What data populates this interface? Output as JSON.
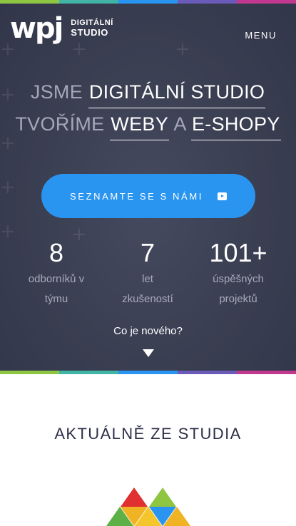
{
  "brand": {
    "logo_mark": "wpj",
    "logo_line1": "DIGITÁLNÍ",
    "logo_line2": "STUDIO"
  },
  "nav": {
    "menu_label": "MENU"
  },
  "hero": {
    "line1_prefix": "JSME",
    "line1_highlight": "DIGITÁLNÍ STUDIO",
    "line2_prefix": "TVOŘÍME",
    "line2_highlight1": "WEBY",
    "line2_connector": "A",
    "line2_highlight2": "E-SHOPY",
    "cta_label": "SEZNAMTE SE S NÁMI",
    "cta_icon": "play-icon"
  },
  "stats": [
    {
      "number": "8",
      "label_line1": "odborníků v",
      "label_line2": "týmu"
    },
    {
      "number": "7",
      "label_line1": "let",
      "label_line2": "zkušeností"
    },
    {
      "number": "101+",
      "label_line1": "úspěšných",
      "label_line2": "projektů"
    }
  ],
  "news_link": "Co je nového?",
  "section": {
    "title": "AKTUÁLNĚ ZE STUDIA"
  },
  "colors": {
    "hero_bg": "#3a3e51",
    "cta": "#2a95f0",
    "stripe": [
      "#8ec642",
      "#42b4a6",
      "#2a95f0",
      "#6a5bb8",
      "#c0398f"
    ]
  }
}
